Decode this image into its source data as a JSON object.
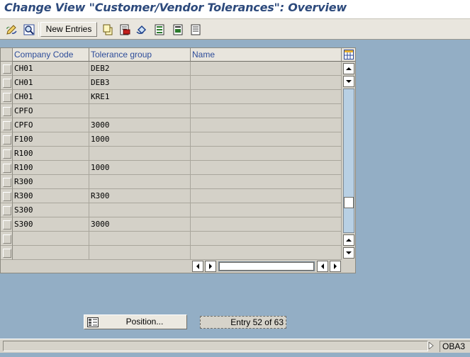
{
  "window": {
    "title": "Change View \"Customer/Vendor Tolerances\": Overview"
  },
  "toolbar": {
    "new_entries_label": "New Entries",
    "icons": [
      "change-display-icon",
      "details-icon",
      "copy-icon",
      "delete-icon",
      "undo-change-icon",
      "select-all-icon",
      "select-block-icon",
      "deselect-all-icon"
    ]
  },
  "table": {
    "columns": [
      "Company Code",
      "Tolerance group",
      "Name"
    ],
    "rows": [
      {
        "company_code": "CH01",
        "tolerance_group": "DEB2",
        "name": ""
      },
      {
        "company_code": "CH01",
        "tolerance_group": "DEB3",
        "name": ""
      },
      {
        "company_code": "CH01",
        "tolerance_group": "KRE1",
        "name": ""
      },
      {
        "company_code": "CPFO",
        "tolerance_group": "",
        "name": ""
      },
      {
        "company_code": "CPFO",
        "tolerance_group": "3000",
        "name": ""
      },
      {
        "company_code": "F100",
        "tolerance_group": "1000",
        "name": ""
      },
      {
        "company_code": "R100",
        "tolerance_group": "",
        "name": ""
      },
      {
        "company_code": "R100",
        "tolerance_group": "1000",
        "name": ""
      },
      {
        "company_code": "R300",
        "tolerance_group": "",
        "name": ""
      },
      {
        "company_code": "R300",
        "tolerance_group": "R300",
        "name": ""
      },
      {
        "company_code": "S300",
        "tolerance_group": "",
        "name": ""
      },
      {
        "company_code": "S300",
        "tolerance_group": "3000",
        "name": ""
      },
      {
        "company_code": "",
        "tolerance_group": "",
        "name": ""
      },
      {
        "company_code": "",
        "tolerance_group": "",
        "name": ""
      }
    ]
  },
  "position_button": {
    "label": "Position..."
  },
  "entry_info": {
    "text": "Entry 52 of 63"
  },
  "status_bar": {
    "message": "",
    "transaction_code": "OBA3"
  },
  "colors": {
    "background": "#93aec5",
    "title": "#2d4a7c",
    "header_text": "#2d4c9a",
    "table_bg": "#d4d1c8",
    "scroll_track": "#b8d0e4"
  }
}
